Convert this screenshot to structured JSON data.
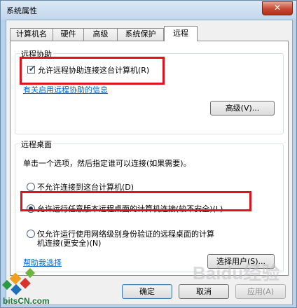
{
  "window": {
    "title": "系统属性",
    "close_glyph": "✕"
  },
  "tabs": [
    "计算机名",
    "硬件",
    "高级",
    "系统保护",
    "远程"
  ],
  "remote_assistance": {
    "group_title": "远程协助",
    "allow_label": "允许远程协助连接这台计算机(R)",
    "allow_checked": true,
    "info_link": "有关启用远程协助的信息",
    "advanced_button": "高级(V)..."
  },
  "remote_desktop": {
    "group_title": "远程桌面",
    "instruction": "单击一个选项，然后指定谁可以连接(如果需要)。",
    "options": [
      "不允许连接到这台计算机(D)",
      "允许运行任意版本远程桌面的计算机连接(较不安全)(L)",
      "仅允许运行使用网络级别身份验证的远程桌面的计算",
      "机连接(更安全)(N)"
    ],
    "selected_option": "允许运行任意版本远程桌面的计算机连接(较不安全)(L)",
    "help_link": "帮助我选择",
    "select_users_button": "选择用户(S)..."
  },
  "footer": {
    "ok": "确定",
    "cancel": "取消",
    "apply": "应用(A)"
  },
  "watermarks": {
    "site": "bitsCN.com",
    "baidu": "Baidu经验"
  },
  "colors": {
    "highlight": "#e0121b",
    "link": "#0066cc"
  }
}
